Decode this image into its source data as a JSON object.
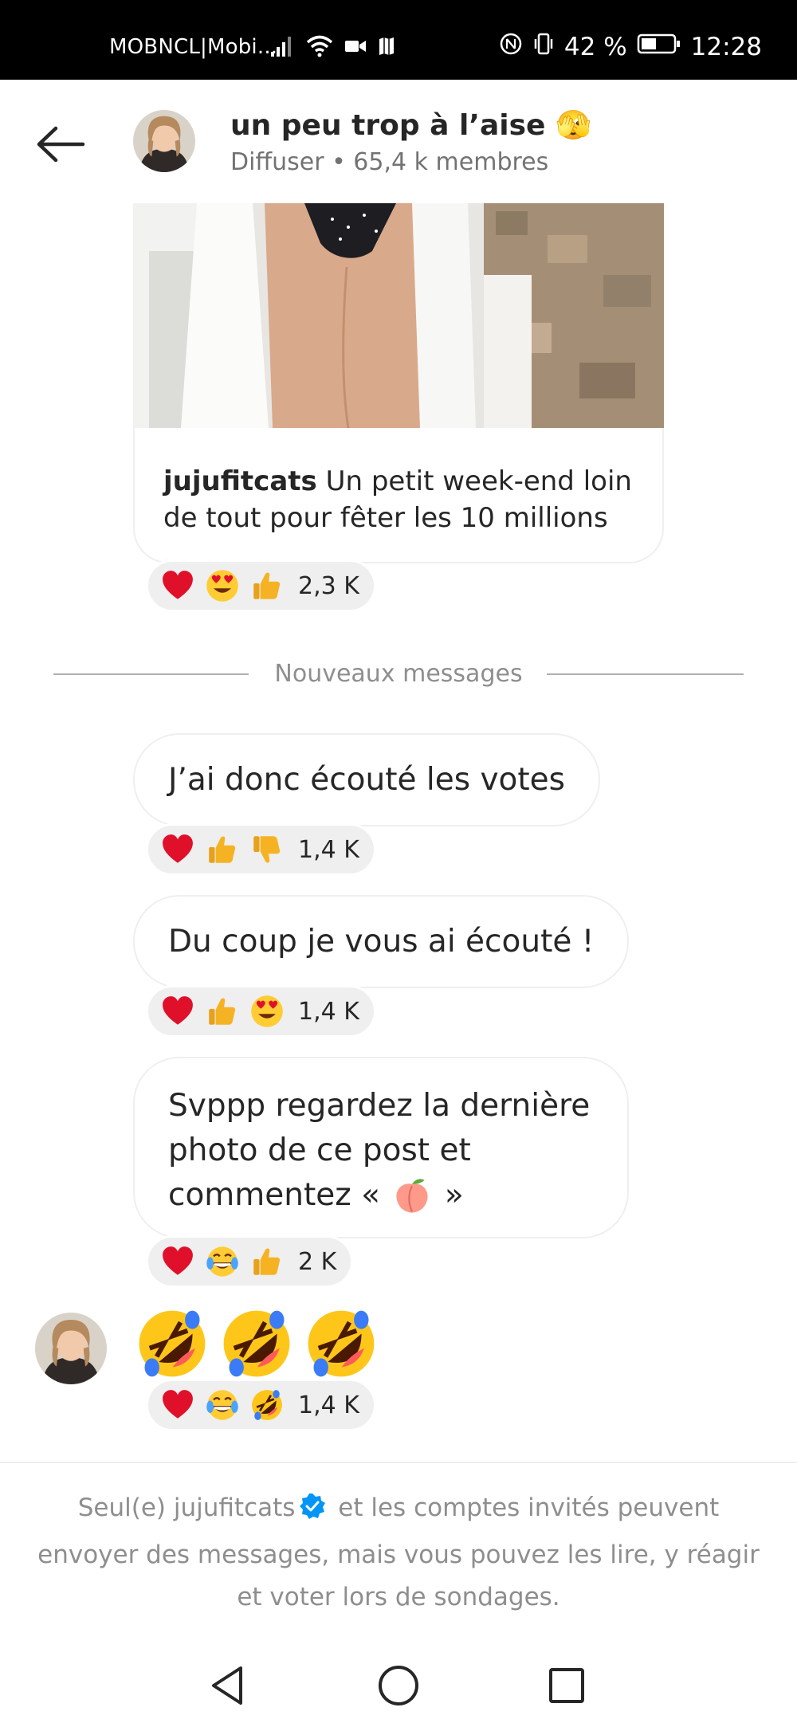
{
  "status_bar": {
    "carrier": "MOBNCL|Mobi...",
    "battery": "42 %",
    "time": "12:28"
  },
  "header": {
    "title": "un peu trop à l’aise 🫣",
    "subtitle": "Diffuser • 65,4 k membres"
  },
  "post": {
    "username": "jujufitcats",
    "caption": " Un petit week-end loin de tout pour fêter les 10 millions ...",
    "reactions": {
      "emojis": [
        "heart",
        "heart-eyes",
        "thumbs-up"
      ],
      "count": "2,3 K"
    }
  },
  "divider": {
    "label": "Nouveaux messages"
  },
  "messages": [
    {
      "text": "J’ai donc écouté les votes",
      "reactions": {
        "emojis": [
          "heart",
          "thumbs-up",
          "thumbs-down"
        ],
        "count": "1,4 K"
      }
    },
    {
      "text": "Du coup je vous ai écouté !",
      "reactions": {
        "emojis": [
          "heart",
          "thumbs-up",
          "heart-eyes"
        ],
        "count": "1,4 K"
      }
    },
    {
      "line1": "Svppp regardez la dernière",
      "line2": "photo de ce post et",
      "line3_prefix": "commentez « ",
      "line3_suffix": " »",
      "reactions": {
        "emojis": [
          "heart",
          "tears-of-joy",
          "thumbs-up"
        ],
        "count": "2 K"
      }
    },
    {
      "emojis": [
        "rolling-laughing",
        "rolling-laughing",
        "rolling-laughing"
      ],
      "reactions": {
        "emojis": [
          "heart",
          "tears-of-joy",
          "rolling-laughing"
        ],
        "count": "1,4 K"
      }
    }
  ],
  "notice": {
    "part1": "Seul(e) jujufitcats",
    "part2": " et les comptes invités peuvent envoyer des messages, mais vous pouvez les lire, y réagir et voter lors de sondages."
  },
  "colors": {
    "text": "#262626",
    "secondary": "#8e8e8e",
    "bubble_border": "#efefef",
    "verified": "#0095f6"
  }
}
